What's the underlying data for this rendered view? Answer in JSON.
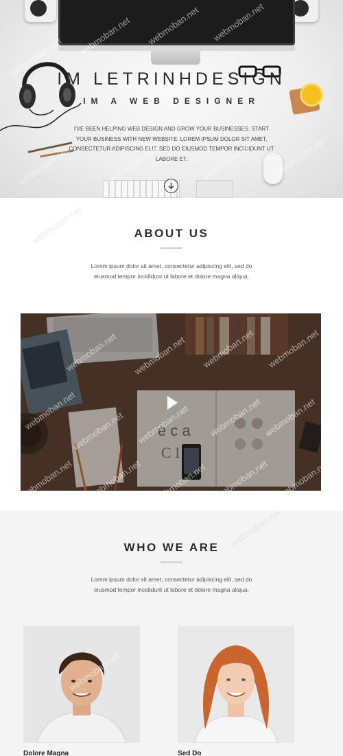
{
  "hero": {
    "title": "IM LETRINHDESIGN",
    "subtitle": "IM A WEB DESIGNER",
    "text": "I'VE BEEN HELPING WEB DESIGN AND GROW YOUR BUSINESSES. START YOUR BUSINESS WITH NEW WEBSITE. LOREM IPSUM DOLOR SIT AMET, CONSECTETUR ADIPISCING ELIT, SED DO EIUSMOD TEMPOR INCIDIDUNT UT LABORE ET.",
    "scroll_icon": "arrow-down-circle-icon"
  },
  "about": {
    "title": "ABOUT US",
    "text": "Lorem ipsum dolor sit amet, consectetur adipiscing elit, sed do eiusmod tempor incididunt ut labore et dolore magna aliqua.",
    "video_icon": "play-icon"
  },
  "who": {
    "title": "WHO WE ARE",
    "text": "Lorem ipsum dolor sit amet, consectetur adipiscing elit, sed do eiusmod tempor incididunt ut labore et dolore magna aliqua.",
    "members": [
      {
        "name": "Dolore Magna"
      },
      {
        "name": "Sed Do"
      }
    ]
  },
  "watermark": "webmoban.net",
  "colors": {
    "heading": "#2c2c2c",
    "accent_coffee": "#f3c222",
    "section_bg_alt": "#f4f4f4"
  }
}
